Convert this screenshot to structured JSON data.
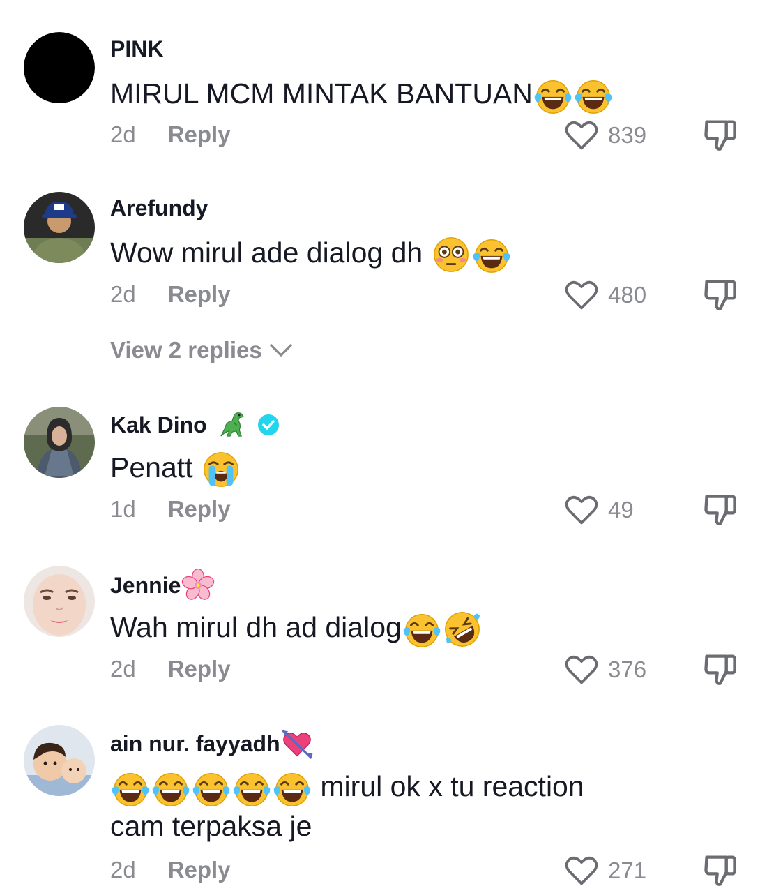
{
  "comments": [
    {
      "username": "PINK",
      "text": "MIRUL MCM MINTAK BANTUAN",
      "text_emoji": [
        "face-with-tears-of-joy",
        "face-with-tears-of-joy"
      ],
      "time": "2d",
      "reply_label": "Reply",
      "likes": "839"
    },
    {
      "username": "Arefundy",
      "text": "Wow mirul ade dialog dh",
      "text_emoji": [
        "flushed-face",
        "face-with-tears-of-joy"
      ],
      "time": "2d",
      "reply_label": "Reply",
      "likes": "480",
      "view_replies": "View 2 replies"
    },
    {
      "username": "Kak Dino",
      "username_emoji": "t-rex",
      "verified": true,
      "text": "Penatt",
      "text_emoji": [
        "loudly-crying-face"
      ],
      "time": "1d",
      "reply_label": "Reply",
      "likes": "49"
    },
    {
      "username": "Jennie",
      "username_emoji": "cherry-blossom",
      "text": "Wah mirul dh ad dialog",
      "text_emoji": [
        "face-with-tears-of-joy",
        "rolling-on-the-floor-laughing"
      ],
      "time": "2d",
      "reply_label": "Reply",
      "likes": "376"
    },
    {
      "username": "ain nur. fayyadh",
      "username_emoji": "heart-with-arrow",
      "text_line1": "mirul ok x tu reaction",
      "text_line2": "cam terpaksa je",
      "text_emoji": [
        "face-with-tears-of-joy",
        "face-with-tears-of-joy",
        "face-with-tears-of-joy",
        "face-with-tears-of-joy",
        "face-with-tears-of-joy"
      ],
      "time": "2d",
      "reply_label": "Reply",
      "likes": "271"
    }
  ],
  "colors": {
    "text": "#161823",
    "muted": "#8a8b91",
    "verified": "#20d5ec",
    "emoji_yellow": "#fbc02d",
    "tear_blue": "#4fc3f7"
  }
}
